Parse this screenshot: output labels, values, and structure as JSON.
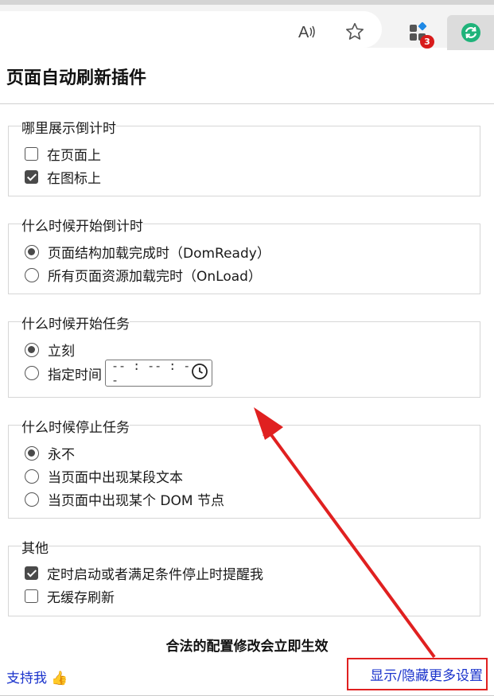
{
  "browser": {
    "read_aloud_icon": "read-aloud-icon",
    "favorite_icon": "star-icon",
    "extensions_icon": "extensions-icon",
    "extensions_badge": "3",
    "active_extension_icon": "refresh-icon"
  },
  "page": {
    "title": "页面自动刷新插件"
  },
  "sections": {
    "where": {
      "legend": "哪里展示倒计时",
      "options": [
        {
          "label": "在页面上",
          "checked": false
        },
        {
          "label": "在图标上",
          "checked": true
        }
      ]
    },
    "when_countdown": {
      "legend": "什么时候开始倒计时",
      "options": [
        {
          "label": "页面结构加载完成时（DomReady）",
          "selected": true
        },
        {
          "label": "所有页面资源加载完时（OnLoad）",
          "selected": false
        }
      ]
    },
    "when_task": {
      "legend": "什么时候开始任务",
      "options": [
        {
          "label": "立刻",
          "selected": true
        },
        {
          "label": "指定时间",
          "selected": false
        }
      ],
      "time_value": "-- : -- : --"
    },
    "when_stop": {
      "legend": "什么时候停止任务",
      "options": [
        {
          "label": "永不",
          "selected": true
        },
        {
          "label": "当页面中出现某段文本",
          "selected": false
        },
        {
          "label": "当页面中出现某个 DOM 节点",
          "selected": false
        }
      ]
    },
    "other": {
      "legend": "其他",
      "options": [
        {
          "label": "定时启动或者满足条件停止时提醒我",
          "checked": true
        },
        {
          "label": "无缓存刷新",
          "checked": false
        }
      ]
    }
  },
  "footer": {
    "notice": "合法的配置修改会立即生效",
    "support": "支持我 👍",
    "more_settings": "显示/隐藏更多设置"
  },
  "colors": {
    "link": "#1a33cc",
    "annotation": "#e02020",
    "accent_refresh": "#1fb37a"
  }
}
